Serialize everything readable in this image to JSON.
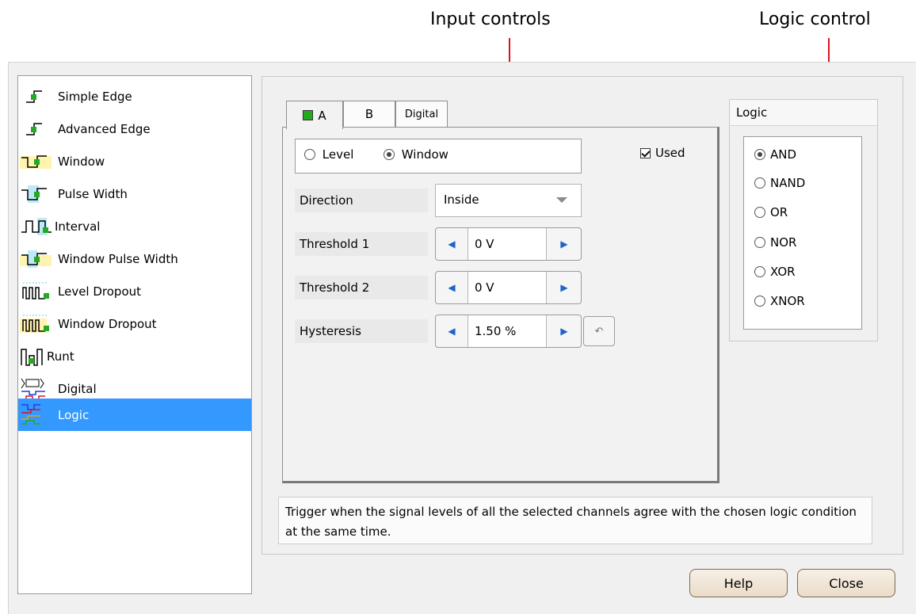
{
  "callouts": {
    "input_controls": "Input controls",
    "logic_control": "Logic control"
  },
  "trigger_types": [
    {
      "label": "Simple Edge",
      "icon": "simple-edge-icon"
    },
    {
      "label": "Advanced Edge",
      "icon": "advanced-edge-icon"
    },
    {
      "label": "Window",
      "icon": "window-icon"
    },
    {
      "label": "Pulse Width",
      "icon": "pulse-width-icon"
    },
    {
      "label": "Interval",
      "icon": "interval-icon"
    },
    {
      "label": "Window Pulse Width",
      "icon": "window-pulse-width-icon"
    },
    {
      "label": "Level Dropout",
      "icon": "level-dropout-icon"
    },
    {
      "label": "Window Dropout",
      "icon": "window-dropout-icon"
    },
    {
      "label": "Runt",
      "icon": "runt-icon"
    },
    {
      "label": "Digital",
      "icon": "digital-icon"
    },
    {
      "label": "Logic",
      "icon": "logic-icon"
    }
  ],
  "selected_trigger": "Logic",
  "tabs": [
    {
      "label": "A",
      "active": true,
      "checked": true
    },
    {
      "label": "B",
      "active": false
    },
    {
      "label": "Digital",
      "active": false
    }
  ],
  "mode": {
    "level_label": "Level",
    "window_label": "Window",
    "selected": "Window",
    "used_label": "Used",
    "used_checked": true
  },
  "direction": {
    "label": "Direction",
    "value": "Inside"
  },
  "threshold1": {
    "label": "Threshold 1",
    "value": "0 V"
  },
  "threshold2": {
    "label": "Threshold 2",
    "value": "0 V"
  },
  "hysteresis": {
    "label": "Hysteresis",
    "value": "1.50 %"
  },
  "logic": {
    "title": "Logic",
    "options": [
      "AND",
      "NAND",
      "OR",
      "NOR",
      "XOR",
      "XNOR"
    ],
    "selected": "AND"
  },
  "description": "Trigger when the signal levels of all the selected channels agree with the chosen logic condition at the same time.",
  "buttons": {
    "help": "Help",
    "close": "Close"
  },
  "colors": {
    "accent": "#3399ff",
    "callout": "#e0131b",
    "step_arrow": "#1e64c8",
    "icon_green": "#22aa22"
  }
}
